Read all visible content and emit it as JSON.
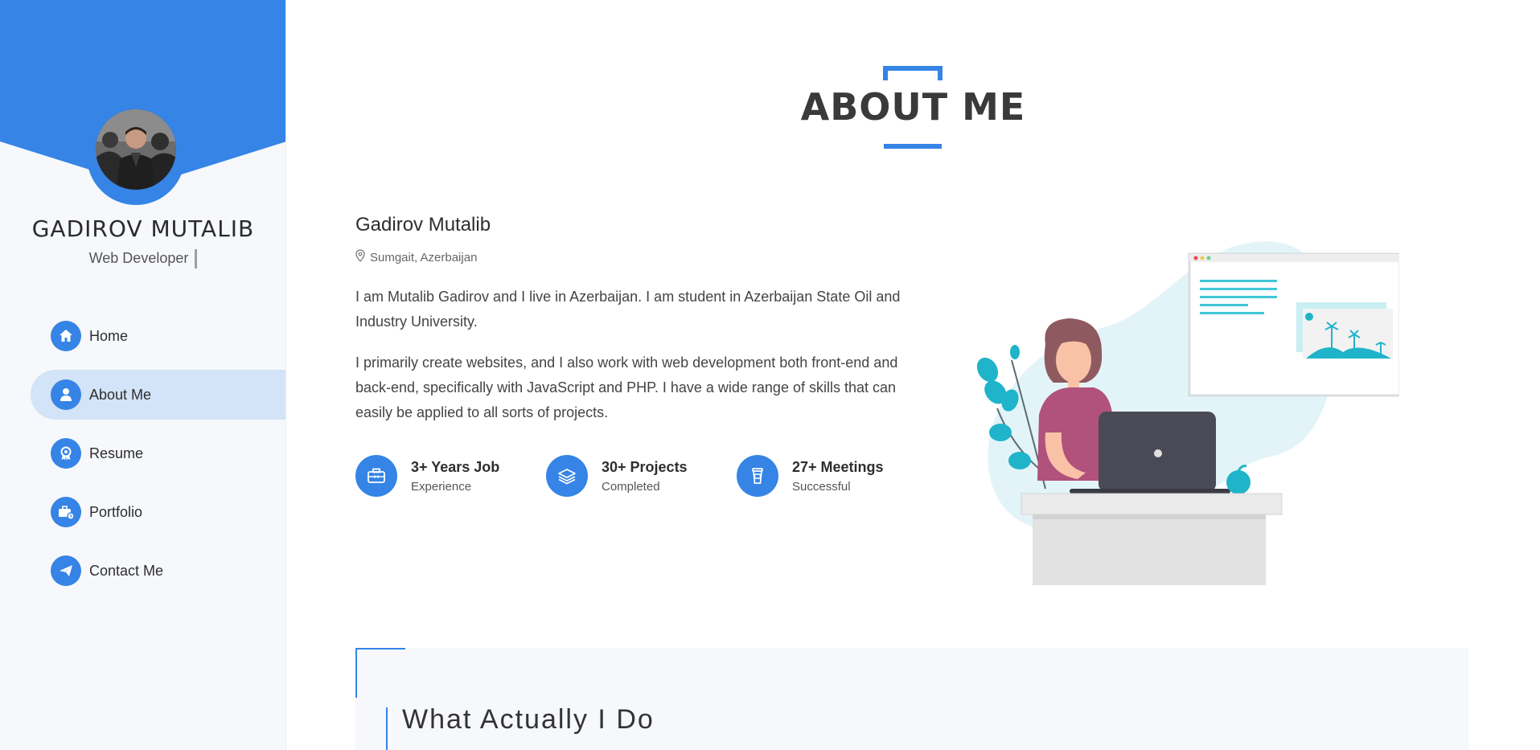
{
  "profile": {
    "name": "GADIROV MUTALIB",
    "role": "Web Developer"
  },
  "nav": {
    "items": [
      {
        "label": "Home",
        "icon": "home-icon"
      },
      {
        "label": "About Me",
        "icon": "user-icon",
        "active": true
      },
      {
        "label": "Resume",
        "icon": "award-icon"
      },
      {
        "label": "Portfolio",
        "icon": "briefcase-icon"
      },
      {
        "label": "Contact Me",
        "icon": "paper-plane-icon"
      }
    ]
  },
  "section": {
    "title": "ABOUT ME"
  },
  "about": {
    "name": "Gadirov Mutalib",
    "location": "Sumgait, Azerbaijan",
    "paragraph1": "I am Mutalib Gadirov and I live in Azerbaijan. I am student in Azerbaijan State Oil and Industry University.",
    "paragraph2": "I primarily create websites, and I also work with web development both front-end and back-end, specifically with JavaScript and PHP. I have a wide range of skills that can easily be applied to all sorts of projects."
  },
  "stats": [
    {
      "title": "3+ Years Job",
      "subtitle": "Experience",
      "icon": "briefcase-icon"
    },
    {
      "title": "30+ Projects",
      "subtitle": "Completed",
      "icon": "layers-icon"
    },
    {
      "title": "27+ Meetings",
      "subtitle": "Successful",
      "icon": "coffee-cup-icon"
    }
  ],
  "services": {
    "title": "What Actually I Do"
  },
  "colors": {
    "accent": "#3584e6",
    "active_nav_bg": "#d3e3f8",
    "sidebar_bg": "#f6f8fb"
  }
}
